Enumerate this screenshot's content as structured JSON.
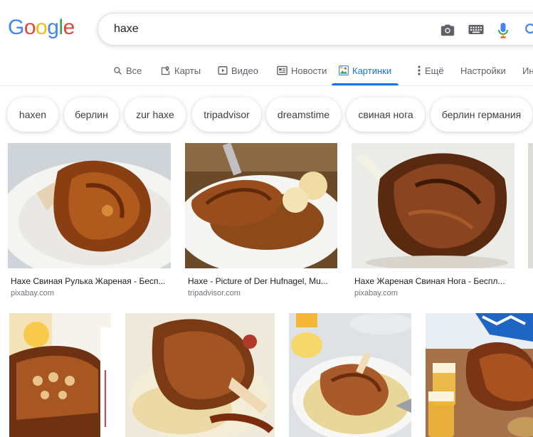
{
  "logo": {
    "letters": [
      "G",
      "o",
      "o",
      "g",
      "l",
      "e"
    ],
    "colors": [
      "#4285F4",
      "#EA4335",
      "#FBBC05",
      "#4285F4",
      "#34A853",
      "#EA4335"
    ]
  },
  "search": {
    "query": "haxe"
  },
  "tabs": [
    {
      "label": "Все",
      "icon": "search-icon"
    },
    {
      "label": "Карты",
      "icon": "map-pin-icon"
    },
    {
      "label": "Видео",
      "icon": "play-icon"
    },
    {
      "label": "Новости",
      "icon": "news-icon"
    },
    {
      "label": "Картинки",
      "icon": "image-icon",
      "active": true
    },
    {
      "label": "Ещё",
      "icon": "more-vert-icon"
    },
    {
      "label": "Настройки"
    },
    {
      "label": "Ин"
    }
  ],
  "chips": [
    "haxen",
    "берлин",
    "zur haxe",
    "tripadvisor",
    "dreamstime",
    "свиная нога",
    "берлин германия"
  ],
  "results_row1": [
    {
      "title": "Haxe Свиная Рулька Жареная - Бесп...",
      "source": "pixabay.com"
    },
    {
      "title": "Haxe - Picture of Der Hufnagel, Mu...",
      "source": "tripadvisor.com"
    },
    {
      "title": "Haxe Жареная Свиная Нога - Беспл...",
      "source": "pixabay.com"
    }
  ],
  "colors": {
    "accent": "#1a73e8",
    "text": "#202124",
    "muted": "#70757a"
  }
}
